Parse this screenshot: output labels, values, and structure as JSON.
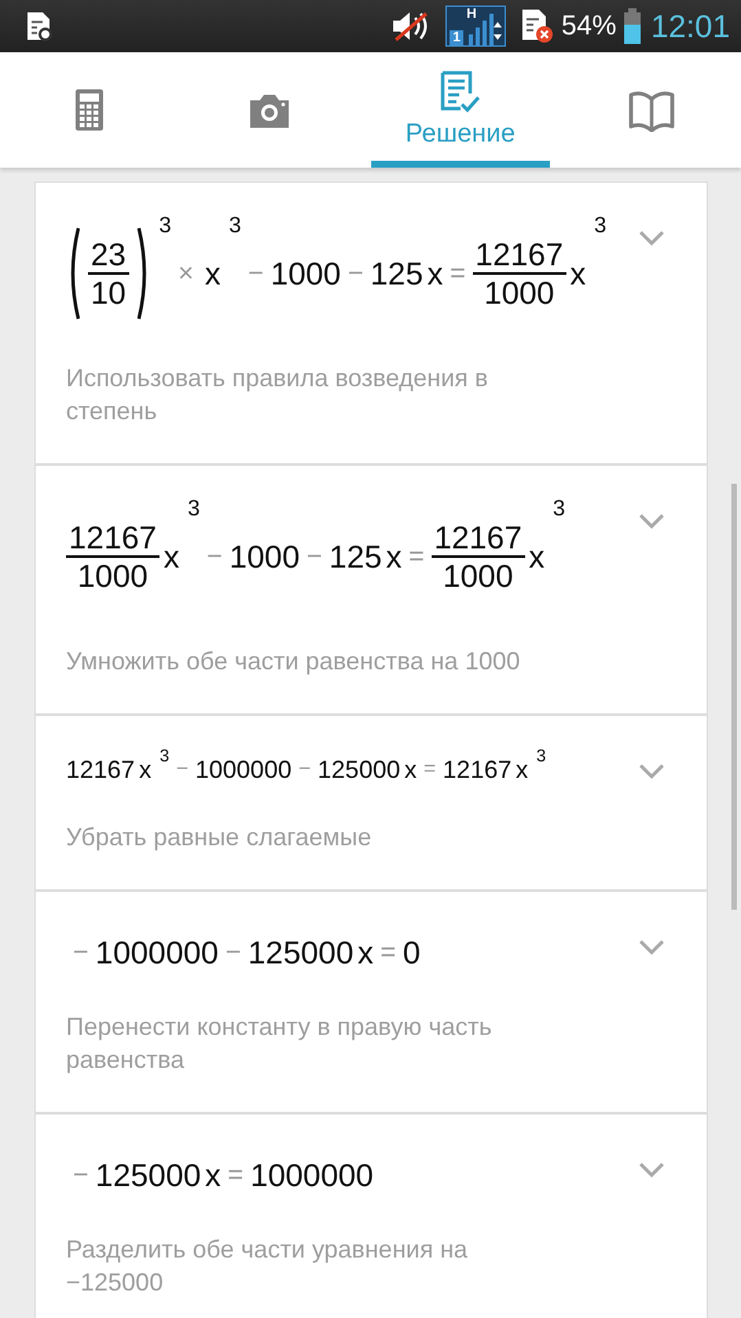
{
  "status_bar": {
    "battery_text": "54%",
    "time": "12:01",
    "network": "H",
    "sim_slot": "1"
  },
  "tabs": [
    {
      "kind": "calculator",
      "selected": false
    },
    {
      "kind": "camera",
      "selected": false
    },
    {
      "kind": "solution",
      "label": "Решение",
      "selected": true
    },
    {
      "kind": "book",
      "selected": false
    }
  ],
  "steps": [
    {
      "expression": [
        {
          "kind": "pfrac",
          "num": "23",
          "den": "10",
          "exp": "3"
        },
        {
          "kind": "op",
          "text": "×"
        },
        {
          "kind": "var",
          "text": "x",
          "exp": "3"
        },
        {
          "kind": "op",
          "text": "−"
        },
        {
          "kind": "num",
          "text": "1000"
        },
        {
          "kind": "op",
          "text": "−"
        },
        {
          "kind": "num",
          "text": "125"
        },
        {
          "kind": "var",
          "text": "x"
        },
        {
          "kind": "op",
          "text": "="
        },
        {
          "kind": "frac",
          "num": "12167",
          "den": "1000"
        },
        {
          "kind": "var",
          "text": "x",
          "exp": "3"
        }
      ],
      "description": "Использовать правила возведения в степень"
    },
    {
      "expression": [
        {
          "kind": "frac",
          "num": "12167",
          "den": "1000"
        },
        {
          "kind": "var",
          "text": "x",
          "exp": "3"
        },
        {
          "kind": "op",
          "text": "−"
        },
        {
          "kind": "num",
          "text": "1000"
        },
        {
          "kind": "op",
          "text": "−"
        },
        {
          "kind": "num",
          "text": "125"
        },
        {
          "kind": "var",
          "text": "x"
        },
        {
          "kind": "op",
          "text": "="
        },
        {
          "kind": "frac",
          "num": "12167",
          "den": "1000"
        },
        {
          "kind": "var",
          "text": "x",
          "exp": "3"
        }
      ],
      "description": "Умножить обе части равенства на 1000"
    },
    {
      "expression": [
        {
          "kind": "num",
          "text": "12167"
        },
        {
          "kind": "var",
          "text": "x",
          "exp": "3"
        },
        {
          "kind": "op",
          "text": "−"
        },
        {
          "kind": "num",
          "text": "1000000"
        },
        {
          "kind": "op",
          "text": "−"
        },
        {
          "kind": "num",
          "text": "125000"
        },
        {
          "kind": "var",
          "text": "x"
        },
        {
          "kind": "op",
          "text": "="
        },
        {
          "kind": "num",
          "text": "12167"
        },
        {
          "kind": "var",
          "text": "x",
          "exp": "3"
        }
      ],
      "description": "Убрать равные слагаемые"
    },
    {
      "expression": [
        {
          "kind": "op",
          "text": "−"
        },
        {
          "kind": "num",
          "text": "1000000"
        },
        {
          "kind": "op",
          "text": "−"
        },
        {
          "kind": "num",
          "text": "125000"
        },
        {
          "kind": "var",
          "text": "x"
        },
        {
          "kind": "op",
          "text": "="
        },
        {
          "kind": "num",
          "text": "0"
        }
      ],
      "description": "Перенести константу в правую часть равенства"
    },
    {
      "expression": [
        {
          "kind": "op",
          "text": "−"
        },
        {
          "kind": "num",
          "text": "125000"
        },
        {
          "kind": "var",
          "text": "x"
        },
        {
          "kind": "op",
          "text": "="
        },
        {
          "kind": "num",
          "text": "1000000"
        }
      ],
      "description": "Разделить обе части уравнения на −125000"
    }
  ]
}
